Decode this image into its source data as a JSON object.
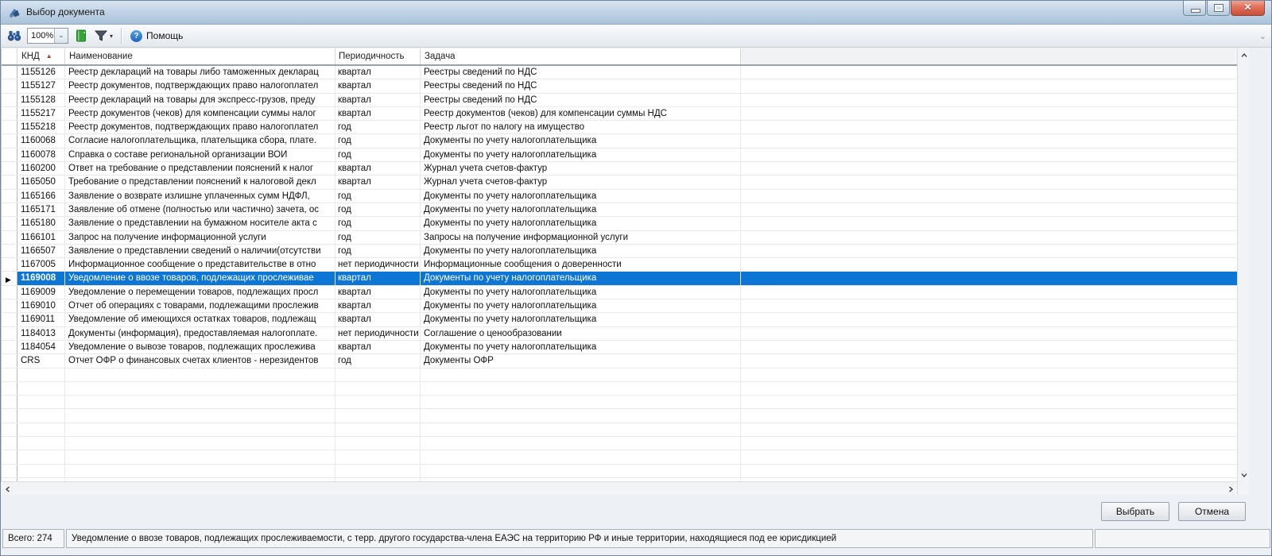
{
  "window": {
    "title": "Выбор документа"
  },
  "toolbar": {
    "zoom_value": "100%",
    "help_label": "Помощь"
  },
  "grid": {
    "columns": [
      {
        "label": "КНД"
      },
      {
        "label": "Наименование"
      },
      {
        "label": "Периодичность"
      },
      {
        "label": "Задача"
      }
    ],
    "sorted_column": "КНД",
    "selected_index": 15,
    "rows": [
      {
        "knd": "1155126",
        "name": "Реестр деклараций на товары либо таможенных декларац",
        "period": "квартал",
        "task": "Реестры сведений по НДС"
      },
      {
        "knd": "1155127",
        "name": "Реестр документов, подтверждающих право налогоплател",
        "period": "квартал",
        "task": "Реестры сведений по НДС"
      },
      {
        "knd": "1155128",
        "name": "Реестр деклараций на товары для экспресс-грузов, преду",
        "period": "квартал",
        "task": "Реестры сведений по НДС"
      },
      {
        "knd": "1155217",
        "name": "Реестр документов (чеков) для компенсации суммы налог",
        "period": "квартал",
        "task": "Реестр документов (чеков) для компенсации суммы НДС"
      },
      {
        "knd": "1155218",
        "name": "Реестр документов, подтверждающих право налогоплател",
        "period": "год",
        "task": "Реестр льгот по налогу на имущество"
      },
      {
        "knd": "1160068",
        "name": "Согласие налогоплательщика, плательщика сбора, плате.",
        "period": "год",
        "task": "Документы по учету налогоплательщика"
      },
      {
        "knd": "1160078",
        "name": "Справка о составе региональной организации ВОИ",
        "period": "год",
        "task": "Документы по учету налогоплательщика"
      },
      {
        "knd": "1160200",
        "name": "Ответ на требование о представлении пояснений к налог",
        "period": "квартал",
        "task": "Журнал учета счетов-фактур"
      },
      {
        "knd": "1165050",
        "name": "Требование о представлении пояснений к налоговой декл",
        "period": "квартал",
        "task": "Журнал учета счетов-фактур"
      },
      {
        "knd": "1165166",
        "name": "Заявление о возврате излишне уплаченных сумм НДФЛ,",
        "period": "год",
        "task": "Документы по учету налогоплательщика"
      },
      {
        "knd": "1165171",
        "name": "Заявление об отмене (полностью или частично) зачета, ос",
        "period": "год",
        "task": "Документы по учету налогоплательщика"
      },
      {
        "knd": "1165180",
        "name": "Заявление о представлении на бумажном носителе акта с",
        "period": "год",
        "task": "Документы по учету налогоплательщика"
      },
      {
        "knd": "1166101",
        "name": "Запрос на получение информационной услуги",
        "period": "год",
        "task": "Запросы на получение информационной услуги"
      },
      {
        "knd": "1166507",
        "name": "Заявление о представлении сведений о наличии(отсутстви",
        "period": "год",
        "task": "Документы по учету налогоплательщика"
      },
      {
        "knd": "1167005",
        "name": "Информационное сообщение о представительстве в отно",
        "period": "нет периодичности",
        "task": "Информационные сообщения о доверенности"
      },
      {
        "knd": "1169008",
        "name": "Уведомление о ввозе товаров, подлежащих прослеживае",
        "period": "квартал",
        "task": "Документы по учету налогоплательщика"
      },
      {
        "knd": "1169009",
        "name": "Уведомление о перемещении товаров, подлежащих просл",
        "period": "квартал",
        "task": "Документы по учету налогоплательщика"
      },
      {
        "knd": "1169010",
        "name": "Отчет об операциях с товарами, подлежащими прослежив",
        "period": "квартал",
        "task": "Документы по учету налогоплательщика"
      },
      {
        "knd": "1169011",
        "name": "Уведомление об имеющихся остатках товаров, подлежащ",
        "period": "квартал",
        "task": "Документы по учету налогоплательщика"
      },
      {
        "knd": "1184013",
        "name": "Документы (информация), предоставляемая налогоплате.",
        "period": "нет периодичности",
        "task": "Соглашение о ценообразовании"
      },
      {
        "knd": "1184054",
        "name": "Уведомление о вывозе товаров, подлежащих прослежива",
        "period": "квартал",
        "task": "Документы по учету налогоплательщика"
      },
      {
        "knd": "CRS",
        "name": "Отчет ОФР о финансовых счетах клиентов - нерезидентов",
        "period": "год",
        "task": "Документы ОФР"
      }
    ]
  },
  "buttons": {
    "select_label": "Выбрать",
    "cancel_label": "Отмена"
  },
  "statusbar": {
    "total": "Всего: 274",
    "description": "Уведомление о ввозе товаров, подлежащих прослеживаемости, с терр. другого государства-члена ЕАЭС на территорию РФ и иные территории, находящиеся под ее юрисдикцией"
  },
  "icons": {
    "sort_asc": "▲",
    "row_marker": "▶",
    "zoom_caret": "▾",
    "filter_caret": "▾",
    "help_glyph": "?",
    "close_glyph": "✕",
    "overflow_glyph": "»"
  },
  "colors": {
    "selection_blue": "#0d76d4",
    "close_red": "#c94f38",
    "book_green": "#3aa03a",
    "icon_blue": "#2d5f9e",
    "sort_red": "#b23b2e",
    "titlebar_blue": "#c2d4e6"
  }
}
